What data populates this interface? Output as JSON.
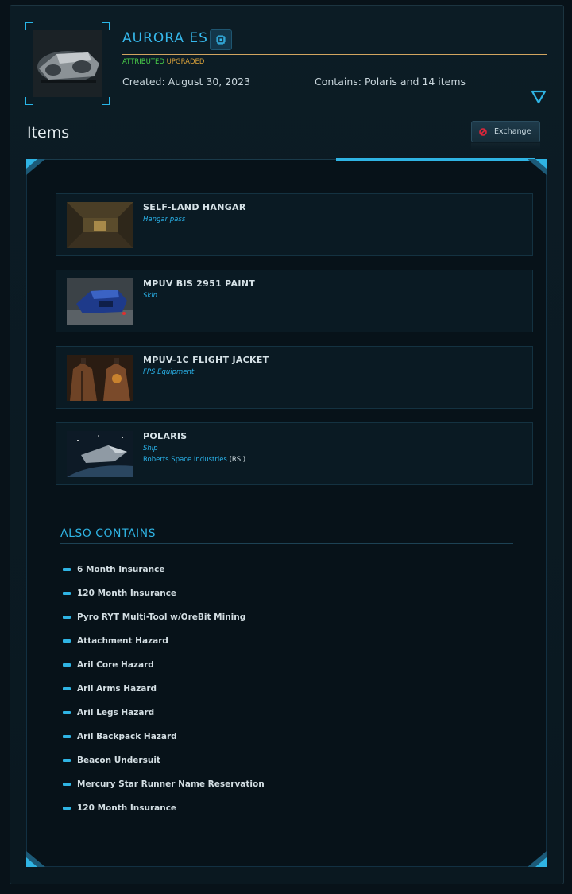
{
  "header": {
    "title": "AURORA ES",
    "tag_attributed": "ATTRIBUTED",
    "tag_upgraded": "UPGRADED",
    "created": "Created: August 30, 2023",
    "contains": "Contains: Polaris and 14 items"
  },
  "items_section": {
    "heading": "Items",
    "exchange_label": "Exchange"
  },
  "items": [
    {
      "name": "SELF-LAND HANGAR",
      "type": "Hangar pass",
      "manufacturer": "",
      "manufacturer_code": ""
    },
    {
      "name": "MPUV BIS 2951 PAINT",
      "type": "Skin",
      "manufacturer": "",
      "manufacturer_code": ""
    },
    {
      "name": "MPUV-1C FLIGHT JACKET",
      "type": "FPS Equipment",
      "manufacturer": "",
      "manufacturer_code": ""
    },
    {
      "name": "POLARIS",
      "type": "Ship",
      "manufacturer": "Roberts Space Industries",
      "manufacturer_code": "(RSI)"
    }
  ],
  "also_contains": {
    "heading": "ALSO CONTAINS",
    "entries": [
      "6 Month Insurance",
      "120 Month Insurance",
      "Pyro RYT Multi-Tool w/OreBit Mining",
      "Attachment Hazard",
      "Aril Core Hazard",
      "Aril Arms Hazard",
      "Aril Legs Hazard",
      "Aril Backpack Hazard",
      "Beacon Undersuit",
      "Mercury Star Runner Name Reservation",
      "120 Month Insurance"
    ]
  },
  "colors": {
    "accent": "#2fb4e4",
    "attributed": "#4ad04a",
    "upgraded": "#d9a13a",
    "divider": "#d2a560"
  },
  "icons": {
    "chip": "chip-icon",
    "expand": "triangle-down-icon",
    "exchange": "ban-icon"
  }
}
